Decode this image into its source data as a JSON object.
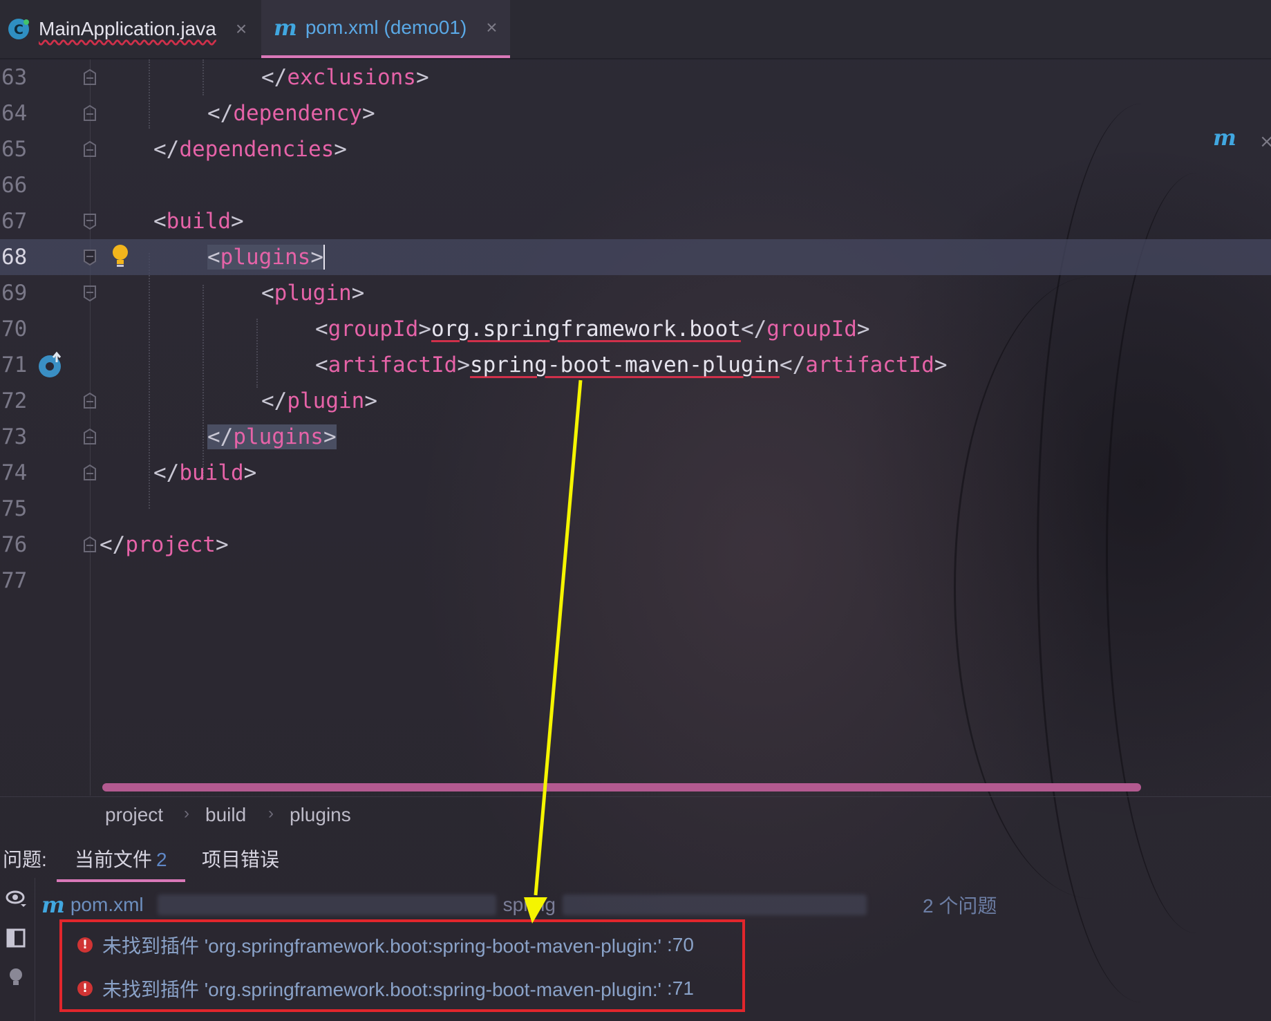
{
  "tabs": [
    {
      "label": "MainApplication.java",
      "icon": "java-class-icon",
      "active": false
    },
    {
      "label": "pom.xml (demo01)",
      "icon": "maven-icon",
      "active": true
    }
  ],
  "close_glyph": "×",
  "maven_icon_glyph": "m",
  "editor": {
    "current_line": "68",
    "lines": [
      {
        "num": "63"
      },
      {
        "num": "64"
      },
      {
        "num": "65"
      },
      {
        "num": "66"
      },
      {
        "num": "67"
      },
      {
        "num": "68"
      },
      {
        "num": "69"
      },
      {
        "num": "70"
      },
      {
        "num": "71"
      },
      {
        "num": "72"
      },
      {
        "num": "73"
      },
      {
        "num": "74"
      },
      {
        "num": "75"
      },
      {
        "num": "76"
      },
      {
        "num": "77"
      }
    ],
    "code": {
      "exclusions_close": "exclusions",
      "dependency_close": "dependency",
      "dependencies_close": "dependencies",
      "build_open": "build",
      "plugins_open": "plugins",
      "plugin_open": "plugin",
      "groupId_tag": "groupId",
      "groupId_value": "org.springframework.boot",
      "artifactId_tag": "artifactId",
      "artifactId_value": "spring-boot-maven-plugin",
      "plugin_close": "plugin",
      "plugins_close": "plugins",
      "build_close": "build",
      "project_close": "project"
    }
  },
  "breadcrumb": [
    "project",
    "build",
    "plugins"
  ],
  "breadcrumb_sep": "›",
  "problems": {
    "label": "问题:",
    "tabs": [
      {
        "label": "当前文件",
        "count": "2",
        "active": true
      },
      {
        "label": "项目错误",
        "count": "",
        "active": false
      }
    ],
    "file_name": "pom.xml",
    "file_path_partial": "spring",
    "issue_count": "2 个问题",
    "errors": [
      {
        "message": "未找到插件 'org.springframework.boot:spring-boot-maven-plugin:'",
        "line_ref": ":70"
      },
      {
        "message": "未找到插件 'org.springframework.boot:spring-boot-maven-plugin:'",
        "line_ref": ":71"
      }
    ]
  },
  "colors": {
    "tag": "#e663a8",
    "accent_underline": "#d978b8",
    "error_box": "#e2262c",
    "arrow": "#f5f500",
    "maven_blue": "#41a7e0"
  }
}
